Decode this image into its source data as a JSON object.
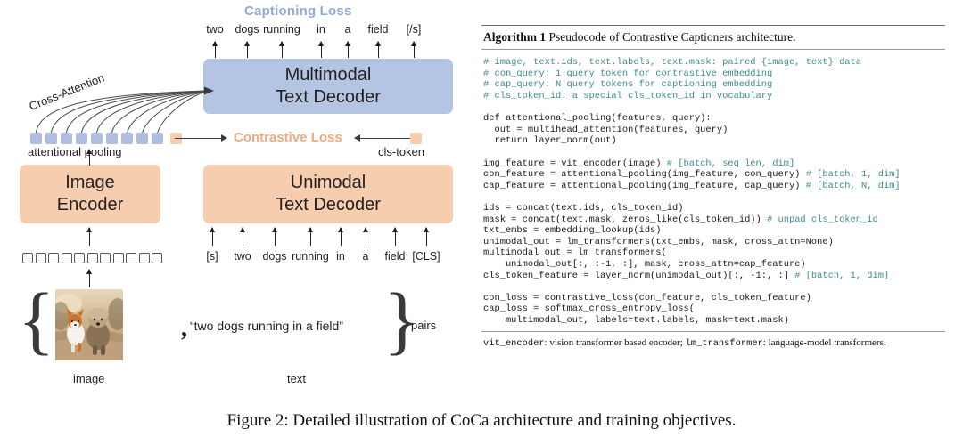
{
  "figure": {
    "caption": "Figure 2: Detailed illustration of CoCa architecture and training objectives."
  },
  "diagram": {
    "captioning_loss_label": "Captioning Loss",
    "contrastive_loss_label": "Contrastive Loss",
    "cross_attention_label": "Cross-Attention",
    "attentional_pooling_label": "attentional pooling",
    "cls_token_label": "cls-token",
    "output_tokens": [
      "two",
      "dogs",
      "running",
      "in",
      "a",
      "field",
      "[/s]"
    ],
    "input_tokens": [
      "[s]",
      "two",
      "dogs",
      "running",
      "in",
      "a",
      "field",
      "[CLS]"
    ],
    "blocks": {
      "multimodal_decoder": {
        "line1": "Multimodal",
        "line2": "Text Decoder"
      },
      "image_encoder": {
        "line1": "Image",
        "line2": "Encoder"
      },
      "unimodal_decoder": {
        "line1": "Unimodal",
        "line2": "Text Decoder"
      }
    },
    "pair": {
      "text_quote": "“two dogs running in a field”",
      "pairs_label": "pairs",
      "image_label": "image",
      "text_label": "text",
      "separator": ","
    },
    "counts": {
      "pooled_blue_squares": 9,
      "pooled_orange_squares": 1,
      "image_patch_squares": 11
    },
    "colors": {
      "blue_block": "#b4c5e4",
      "blue_square": "#adbedf",
      "orange_block": "#f6cdae",
      "captioning_loss_text": "#8fa9df",
      "contrastive_loss_text": "#f0a87f",
      "arrow": "#3a3a3c",
      "patch_border": "#58585a"
    }
  },
  "algorithm": {
    "label": "Algorithm 1",
    "title": "Pseudocode of Contrastive Captioners architecture.",
    "code_lines": [
      {
        "text": "# image, text.ids, text.labels, text.mask: paired {image, text} data",
        "comment": true
      },
      {
        "text": "# con_query: 1 query token for contrastive embedding",
        "comment": true
      },
      {
        "text": "# cap_query: N query tokens for captioning embedding",
        "comment": true
      },
      {
        "text": "# cls_token_id: a special cls_token_id in vocabulary",
        "comment": true
      },
      {
        "text": "",
        "comment": false
      },
      {
        "text": "def attentional_pooling(features, query):",
        "comment": false
      },
      {
        "text": "  out = multihead_attention(features, query)",
        "comment": false
      },
      {
        "text": "  return layer_norm(out)",
        "comment": false
      },
      {
        "text": "",
        "comment": false
      },
      {
        "text": "img_feature = vit_encoder(image) ",
        "tail": "# [batch, seq_len, dim]"
      },
      {
        "text": "con_feature = attentional_pooling(img_feature, con_query) ",
        "tail": "# [batch, 1, dim]"
      },
      {
        "text": "cap_feature = attentional_pooling(img_feature, cap_query) ",
        "tail": "# [batch, N, dim]"
      },
      {
        "text": "",
        "comment": false
      },
      {
        "text": "ids = concat(text.ids, cls_token_id)",
        "comment": false
      },
      {
        "text": "mask = concat(text.mask, zeros_like(cls_token_id)) ",
        "tail": "# unpad cls_token_id"
      },
      {
        "text": "txt_embs = embedding_lookup(ids)",
        "comment": false
      },
      {
        "text": "unimodal_out = lm_transformers(txt_embs, mask, cross_attn=None)",
        "comment": false
      },
      {
        "text": "multimodal_out = lm_transformers(",
        "comment": false
      },
      {
        "text": "    unimodal_out[:, :-1, :], mask, cross_attn=cap_feature)",
        "comment": false
      },
      {
        "text": "cls_token_feature = layer_norm(unimodal_out)[:, -1:, :] ",
        "tail": "# [batch, 1, dim]"
      },
      {
        "text": "",
        "comment": false
      },
      {
        "text": "con_loss = contrastive_loss(con_feature, cls_token_feature)",
        "comment": false
      },
      {
        "text": "cap_loss = softmax_cross_entropy_loss(",
        "comment": false
      },
      {
        "text": "    multimodal_out, labels=text.labels, mask=text.mask)",
        "comment": false
      }
    ],
    "footnote_parts": {
      "mono1": "vit_encoder",
      "text1": ": vision transformer based encoder; ",
      "mono2": "lm_transformer",
      "text2": ": language-model transformers."
    }
  }
}
